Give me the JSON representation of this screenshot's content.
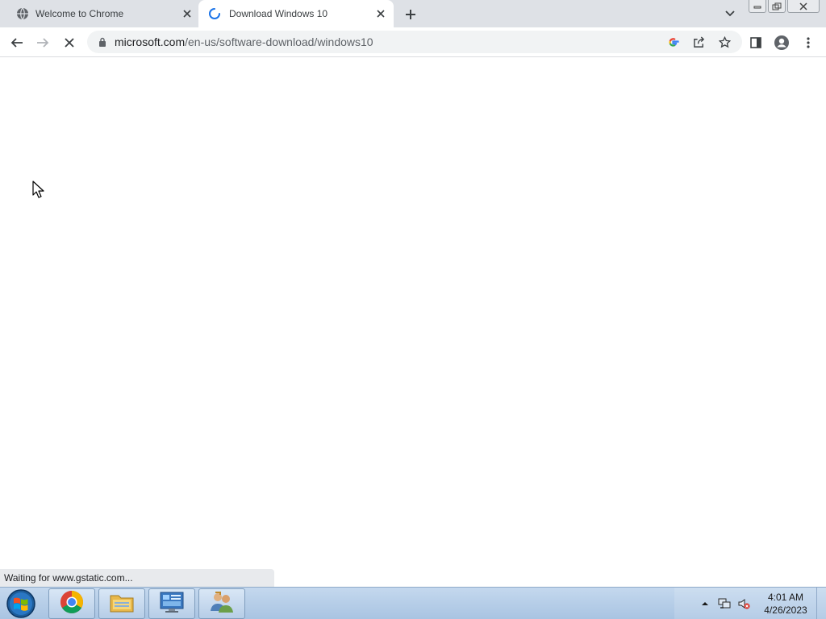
{
  "browser": {
    "tabs": [
      {
        "title": "Welcome to Chrome",
        "icon": "globe-icon",
        "active": false
      },
      {
        "title": "Download Windows 10",
        "icon": "loading-spinner-icon",
        "active": true
      }
    ],
    "url_host": "microsoft.com",
    "url_path": "/en-us/software-download/windows10",
    "status": "Waiting for www.gstatic.com..."
  },
  "taskbar": {
    "apps": [
      "chrome-icon",
      "file-explorer-icon",
      "control-panel-icon",
      "users-icon"
    ],
    "time": "4:01 AM",
    "date": "4/26/2023"
  },
  "colors": {
    "tabstrip": "#dee1e6",
    "omnibox": "#f1f3f4",
    "accent": "#1a73e8",
    "taskbar": "#b6cde7"
  }
}
